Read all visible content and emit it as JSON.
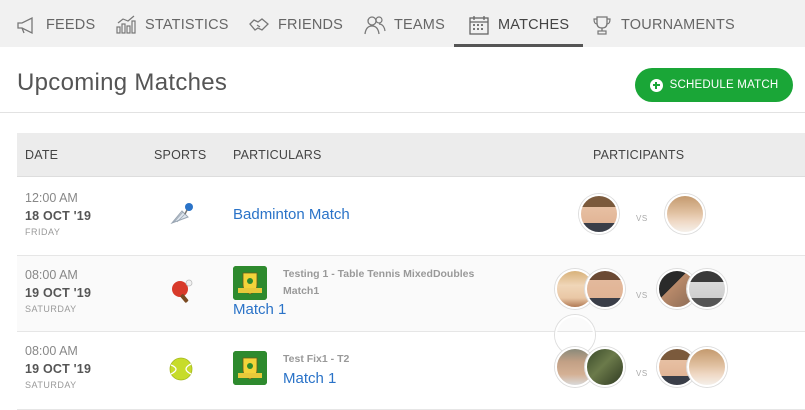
{
  "nav": {
    "feeds": "FEEDS",
    "statistics": "STATISTICS",
    "friends": "FRIENDS",
    "teams": "TEAMS",
    "matches": "MATCHES",
    "tournaments": "TOURNAMENTS"
  },
  "page": {
    "title": "Upcoming Matches",
    "schedule_button": "SCHEDULE MATCH"
  },
  "table": {
    "headers": {
      "date": "DATE",
      "sports": "SPORTS",
      "particulars": "PARTICULARS",
      "participants": "PARTICIPANTS"
    },
    "rows": [
      {
        "time": "12:00 AM",
        "date": "18 OCT '19",
        "day": "FRIDAY",
        "sport": "badminton",
        "subtitle": "",
        "subtitle2": "",
        "name": "Badminton Match",
        "vs": "VS"
      },
      {
        "time": "08:00 AM",
        "date": "19 OCT '19",
        "day": "SATURDAY",
        "sport": "table-tennis",
        "subtitle": "Testing 1 - Table Tennis MixedDoubles",
        "subtitle2": "Match1",
        "name": "Match 1",
        "vs": "VS"
      },
      {
        "time": "08:00 AM",
        "date": "19 OCT '19",
        "day": "SATURDAY",
        "sport": "tennis",
        "subtitle": "Test Fix1 - T2",
        "subtitle2": "",
        "name": "Match 1",
        "vs": "VS"
      }
    ]
  },
  "colors": {
    "accent": "#1aa637",
    "link": "#2a73c8",
    "header_bg": "#ececec"
  },
  "icons": {
    "feeds": "megaphone-icon",
    "statistics": "bar-chart-icon",
    "friends": "handshake-icon",
    "teams": "people-icon",
    "matches": "calendar-icon",
    "tournaments": "trophy-icon"
  }
}
